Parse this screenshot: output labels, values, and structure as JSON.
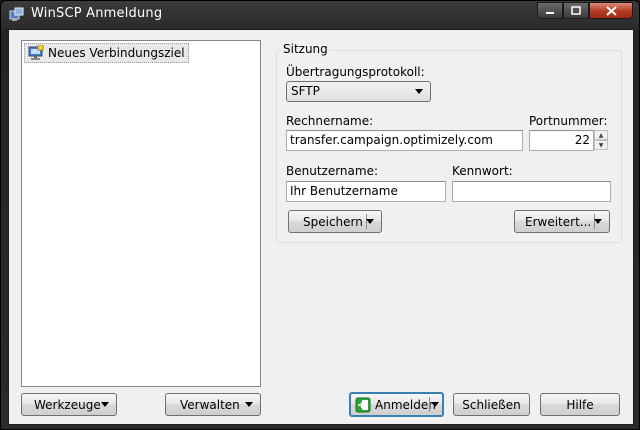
{
  "window": {
    "title": "WinSCP Anmeldung"
  },
  "tree": {
    "items": [
      {
        "label": "Neues Verbindungsziel"
      }
    ]
  },
  "session": {
    "group_title": "Sitzung",
    "protocol_label": "Übertragungsprotokoll:",
    "protocol_value": "SFTP",
    "host_label": "Rechnername:",
    "host_value": "transfer.campaign.optimizely.com",
    "port_label": "Portnummer:",
    "port_value": "22",
    "user_label": "Benutzername:",
    "user_value": "Ihr Benutzername",
    "password_label": "Kennwort:",
    "password_value": "",
    "save_label": "Speichern",
    "advanced_label": "Erweitert..."
  },
  "bottom": {
    "tools_label": "Werkzeuge",
    "manage_label": "Verwalten",
    "login_label": "Anmelden",
    "close_label": "Schließen",
    "help_label": "Hilfe"
  },
  "icons": {
    "app": "winscp-app-icon",
    "site": "computer-site-icon",
    "login": "login-green-icon"
  }
}
